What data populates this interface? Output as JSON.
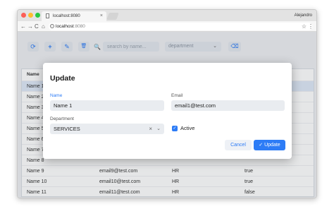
{
  "browser": {
    "tab_title": "localhost:8080",
    "tab_close": "×",
    "user": "Alejandro",
    "url_host": "localhost",
    "url_port": ":8080",
    "back_icon": "←",
    "forward_icon": "→",
    "reload_icon": "C",
    "home_icon": "⌂",
    "star_icon": "☆",
    "menu_icon": "⋮"
  },
  "toolbar": {
    "refresh_icon": "⟳",
    "add_icon": "+",
    "edit_icon": "✎",
    "delete_icon": "🗑",
    "search_icon": "🔍",
    "search_placeholder": "search by name...",
    "department_placeholder": "department",
    "dropdown_icon": "⌄",
    "clear_filter_icon": "⌫"
  },
  "grid": {
    "header_name": "Name",
    "rows": [
      {
        "name": "Name 1"
      },
      {
        "name": "Name 2"
      },
      {
        "name": "Name 3"
      },
      {
        "name": "Name 4"
      },
      {
        "name": "Name 5"
      },
      {
        "name": "Name 6"
      },
      {
        "name": "Name 7"
      },
      {
        "name": "Name 8"
      },
      {
        "name": "Name 9",
        "email": "email9@test.com",
        "department": "HR",
        "active": "true"
      },
      {
        "name": "Name 10",
        "email": "email10@test.com",
        "department": "HR",
        "active": "true"
      },
      {
        "name": "Name 11",
        "email": "email11@test.com",
        "department": "HR",
        "active": "false"
      }
    ]
  },
  "dialog": {
    "title": "Update",
    "name_label": "Name",
    "name_value": "Name 1",
    "email_label": "Email",
    "email_value": "email1@test.com",
    "department_label": "Department",
    "department_value": "SERVICES",
    "clear_icon": "×",
    "dropdown_icon": "⌄",
    "active_label": "Active",
    "active_checked": true,
    "check_icon": "✓",
    "cancel_label": "Cancel",
    "update_label": "✓ Update"
  },
  "colors": {
    "accent": "#2d7cf6",
    "field_bg": "#e9ecf0",
    "selected_row": "#dfe9f8"
  }
}
